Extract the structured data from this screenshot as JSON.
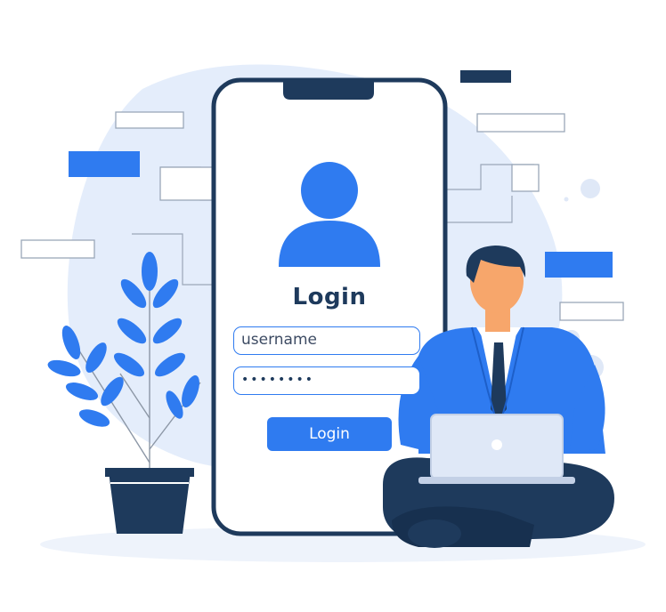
{
  "login_form": {
    "title": "Login",
    "username_placeholder": "username",
    "password_mask": "••••••••",
    "submit_label": "Login"
  },
  "colors": {
    "accent": "#2f7bf0",
    "navy": "#1e3a5c",
    "blob": "#e4edfb",
    "phone_outline": "#1e3a5c"
  },
  "icons": {
    "avatar": "user-avatar-icon",
    "plant": "potted-plant-illustration",
    "person": "man-with-laptop-illustration"
  }
}
